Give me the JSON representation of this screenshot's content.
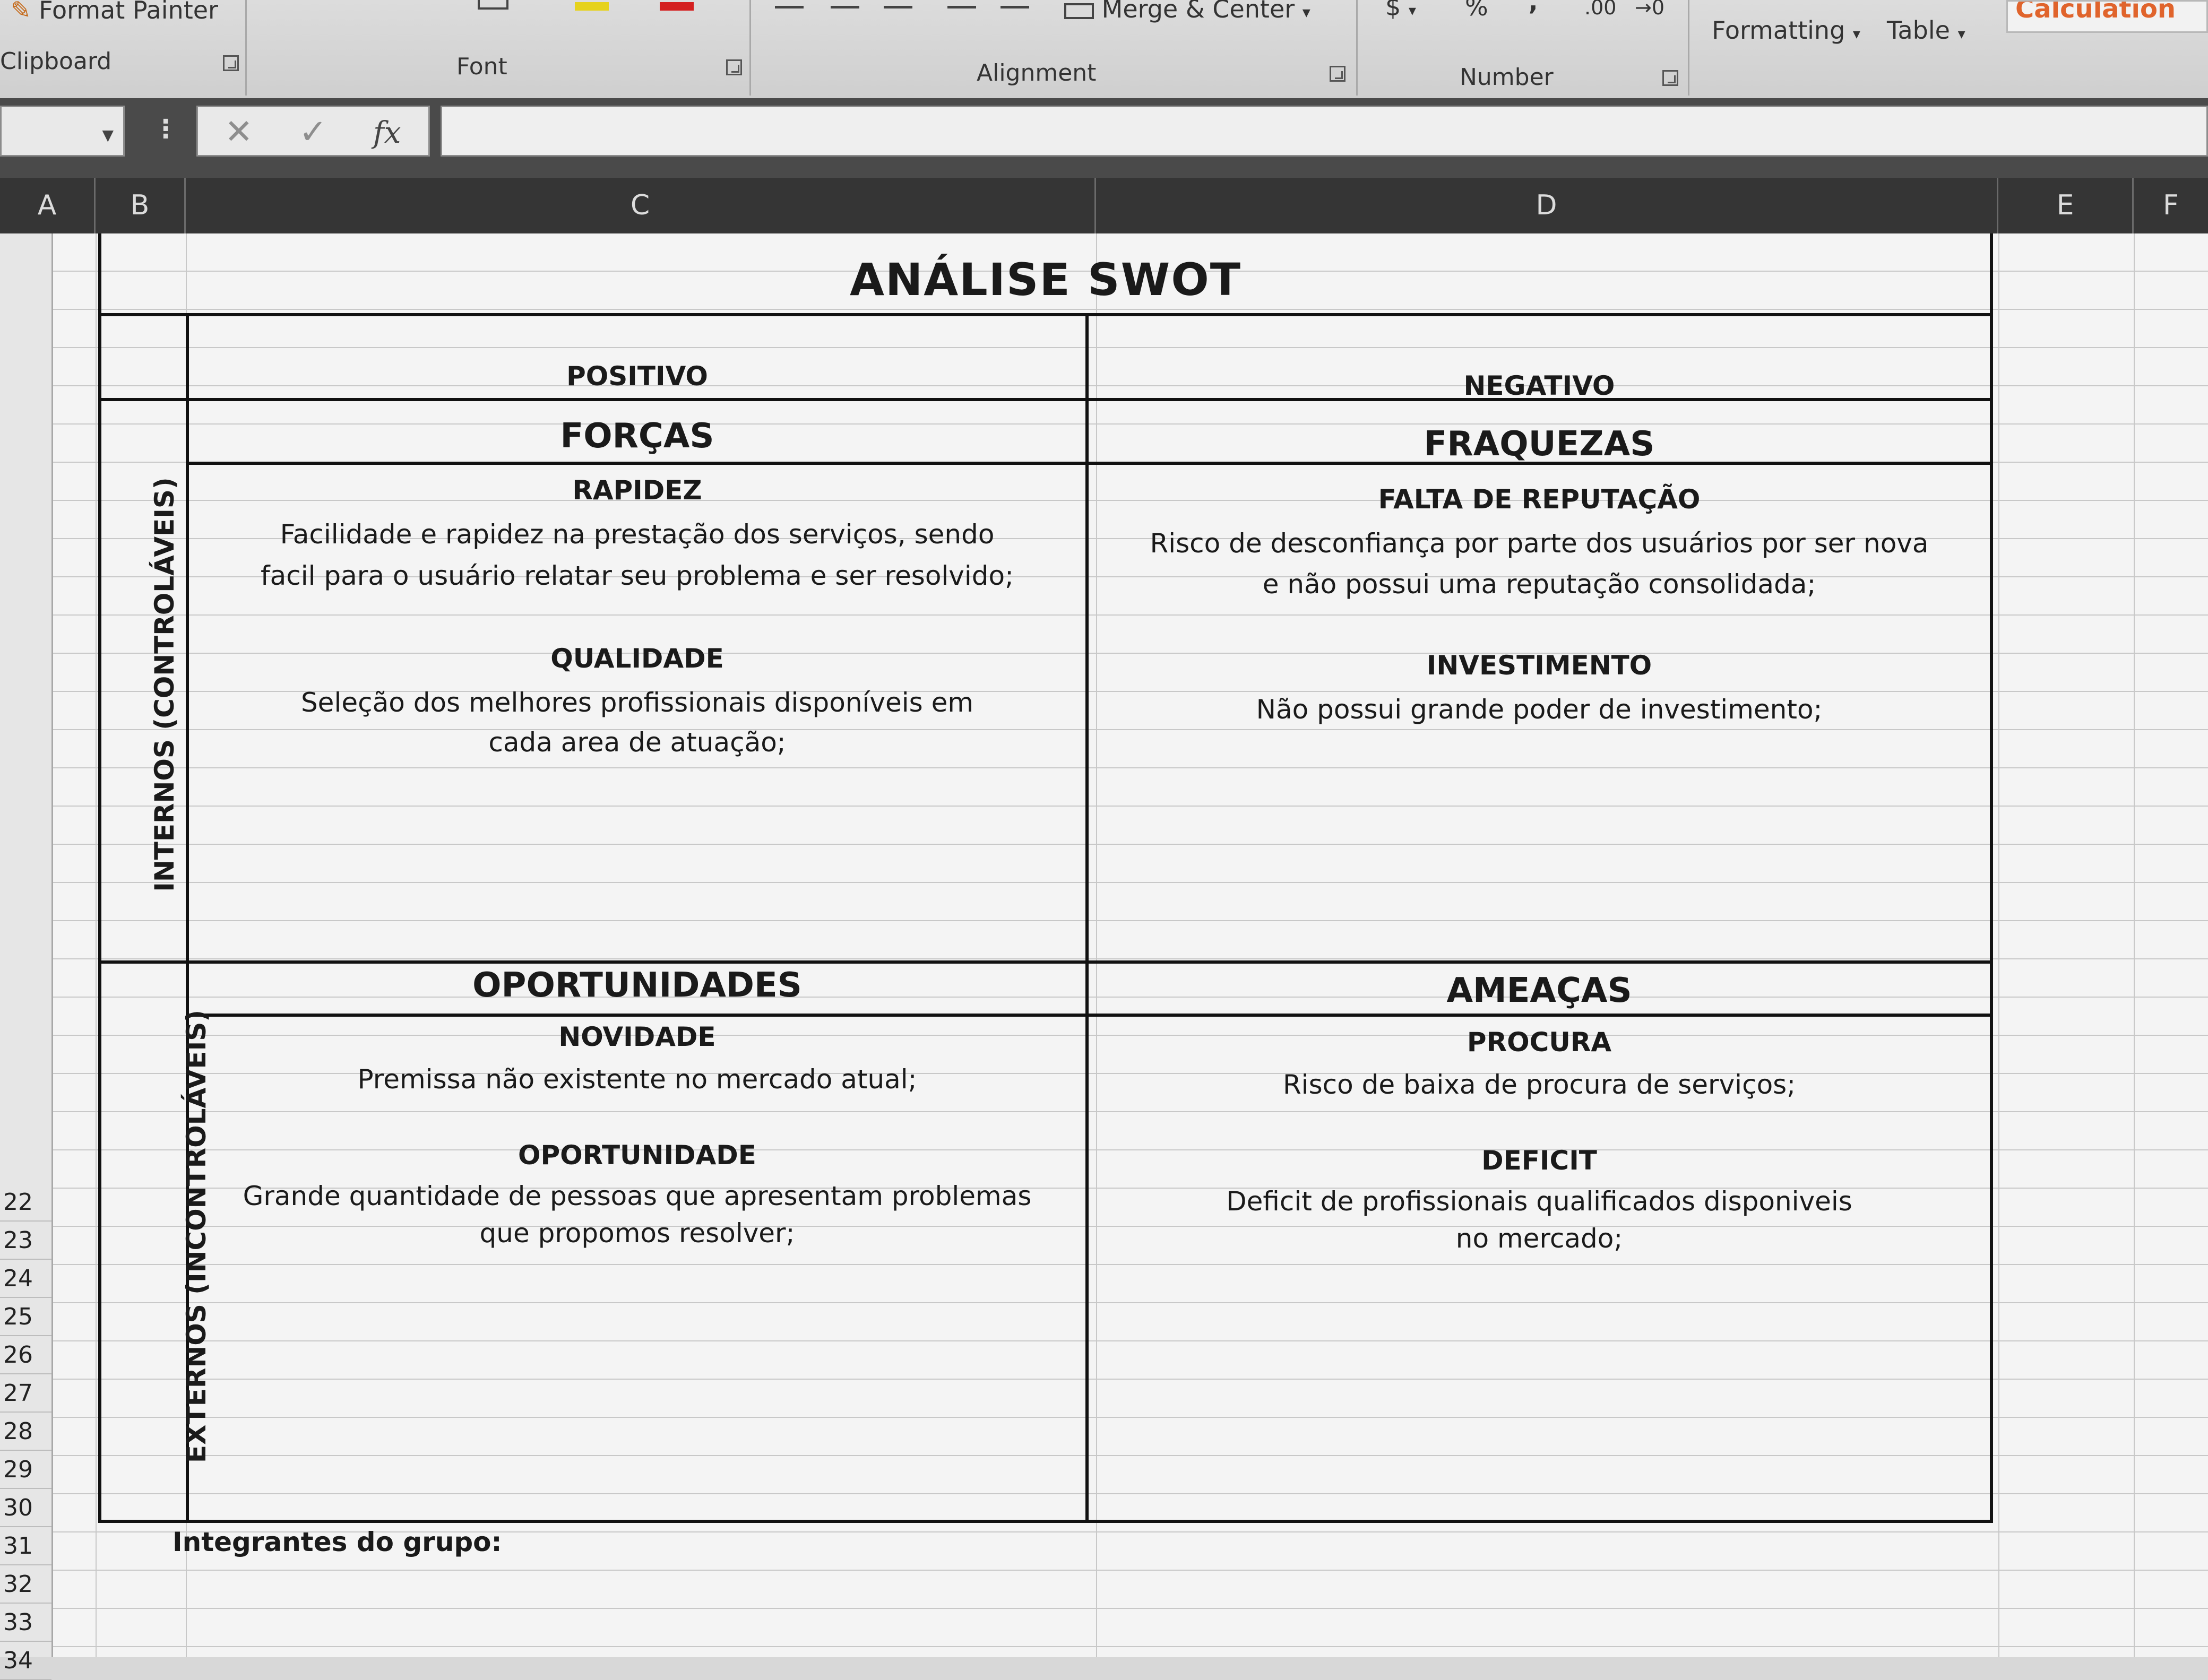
{
  "ribbon": {
    "format_painter": "Format Painter",
    "merge_center": "Merge & Center",
    "currency_symbol": "$",
    "percent_symbol": "%",
    "comma_symbol": ",",
    "increase_decimal": ".00",
    "decrease_decimal": "→0",
    "conditional_formatting": "Formatting",
    "format_as_table": "Table",
    "calculation_style": "Calculation",
    "groups": {
      "clipboard": "Clipboard",
      "font": "Font",
      "alignment": "Alignment",
      "number": "Number"
    },
    "colors": {
      "highlight_swatch": "#e6d21c",
      "font_color_swatch": "#d42020",
      "calculation_text": "#e0642c"
    }
  },
  "formula_bar": {
    "name_box": "",
    "cancel_icon": "close-icon",
    "enter_icon": "check-icon",
    "fx_label": "fx",
    "formula": ""
  },
  "columns": [
    "A",
    "B",
    "C",
    "D",
    "E",
    "F"
  ],
  "rows": [
    "22",
    "23",
    "24",
    "25",
    "26",
    "27",
    "28",
    "29",
    "30",
    "31",
    "32",
    "33",
    "34"
  ],
  "swot": {
    "title": "ANÁLISE SWOT",
    "positive": "POSITIVO",
    "negative": "NEGATIVO",
    "internal_label": "INTERNOS (CONTROLÁVEIS)",
    "external_label": "EXTERNOS (INCONTROLÁVEIS)",
    "strengths": {
      "title": "FORÇAS",
      "items": [
        {
          "title": "RAPIDEZ",
          "lines": [
            "Facilidade e rapidez na prestação dos serviços, sendo",
            "facil para o usuário relatar seu problema e ser resolvido;"
          ]
        },
        {
          "title": "QUALIDADE",
          "lines": [
            "Seleção dos melhores profissionais disponíveis em",
            "cada area de atuação;"
          ]
        }
      ]
    },
    "weaknesses": {
      "title": "FRAQUEZAS",
      "items": [
        {
          "title": "FALTA DE REPUTAÇÃO",
          "lines": [
            "Risco de desconfiança por parte dos usuários por ser nova",
            "e não possui uma reputação consolidada;"
          ]
        },
        {
          "title": "INVESTIMENTO",
          "lines": [
            "Não possui grande poder de investimento;"
          ]
        }
      ]
    },
    "opportunities": {
      "title": "OPORTUNIDADES",
      "items": [
        {
          "title": "NOVIDADE",
          "lines": [
            "Premissa não existente no mercado atual;"
          ]
        },
        {
          "title": "OPORTUNIDADE",
          "lines": [
            "Grande quantidade de pessoas que apresentam problemas",
            "que propomos resolver;"
          ]
        }
      ]
    },
    "threats": {
      "title": "AMEAÇAS",
      "items": [
        {
          "title": "PROCURA",
          "lines": [
            "Risco de baixa de procura de serviços;"
          ]
        },
        {
          "title": "DEFICIT",
          "lines": [
            "Deficit de profissionais qualificados disponiveis",
            "no mercado;"
          ]
        }
      ]
    },
    "members_label": "Integrantes do grupo:"
  }
}
